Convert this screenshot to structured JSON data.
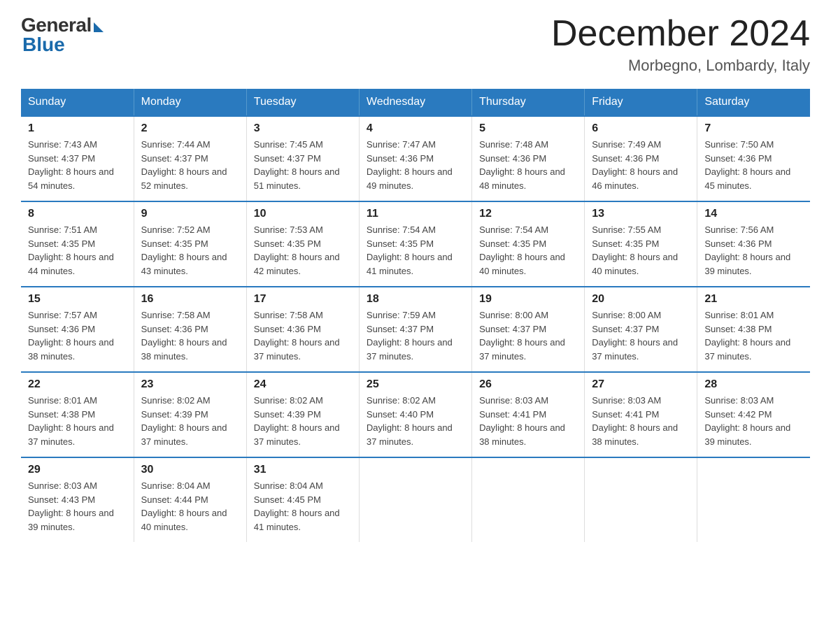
{
  "logo": {
    "general": "General",
    "blue": "Blue"
  },
  "header": {
    "month": "December 2024",
    "location": "Morbegno, Lombardy, Italy"
  },
  "days_of_week": [
    "Sunday",
    "Monday",
    "Tuesday",
    "Wednesday",
    "Thursday",
    "Friday",
    "Saturday"
  ],
  "weeks": [
    [
      {
        "day": "1",
        "sunrise": "7:43 AM",
        "sunset": "4:37 PM",
        "daylight": "8 hours and 54 minutes."
      },
      {
        "day": "2",
        "sunrise": "7:44 AM",
        "sunset": "4:37 PM",
        "daylight": "8 hours and 52 minutes."
      },
      {
        "day": "3",
        "sunrise": "7:45 AM",
        "sunset": "4:37 PM",
        "daylight": "8 hours and 51 minutes."
      },
      {
        "day": "4",
        "sunrise": "7:47 AM",
        "sunset": "4:36 PM",
        "daylight": "8 hours and 49 minutes."
      },
      {
        "day": "5",
        "sunrise": "7:48 AM",
        "sunset": "4:36 PM",
        "daylight": "8 hours and 48 minutes."
      },
      {
        "day": "6",
        "sunrise": "7:49 AM",
        "sunset": "4:36 PM",
        "daylight": "8 hours and 46 minutes."
      },
      {
        "day": "7",
        "sunrise": "7:50 AM",
        "sunset": "4:36 PM",
        "daylight": "8 hours and 45 minutes."
      }
    ],
    [
      {
        "day": "8",
        "sunrise": "7:51 AM",
        "sunset": "4:35 PM",
        "daylight": "8 hours and 44 minutes."
      },
      {
        "day": "9",
        "sunrise": "7:52 AM",
        "sunset": "4:35 PM",
        "daylight": "8 hours and 43 minutes."
      },
      {
        "day": "10",
        "sunrise": "7:53 AM",
        "sunset": "4:35 PM",
        "daylight": "8 hours and 42 minutes."
      },
      {
        "day": "11",
        "sunrise": "7:54 AM",
        "sunset": "4:35 PM",
        "daylight": "8 hours and 41 minutes."
      },
      {
        "day": "12",
        "sunrise": "7:54 AM",
        "sunset": "4:35 PM",
        "daylight": "8 hours and 40 minutes."
      },
      {
        "day": "13",
        "sunrise": "7:55 AM",
        "sunset": "4:35 PM",
        "daylight": "8 hours and 40 minutes."
      },
      {
        "day": "14",
        "sunrise": "7:56 AM",
        "sunset": "4:36 PM",
        "daylight": "8 hours and 39 minutes."
      }
    ],
    [
      {
        "day": "15",
        "sunrise": "7:57 AM",
        "sunset": "4:36 PM",
        "daylight": "8 hours and 38 minutes."
      },
      {
        "day": "16",
        "sunrise": "7:58 AM",
        "sunset": "4:36 PM",
        "daylight": "8 hours and 38 minutes."
      },
      {
        "day": "17",
        "sunrise": "7:58 AM",
        "sunset": "4:36 PM",
        "daylight": "8 hours and 37 minutes."
      },
      {
        "day": "18",
        "sunrise": "7:59 AM",
        "sunset": "4:37 PM",
        "daylight": "8 hours and 37 minutes."
      },
      {
        "day": "19",
        "sunrise": "8:00 AM",
        "sunset": "4:37 PM",
        "daylight": "8 hours and 37 minutes."
      },
      {
        "day": "20",
        "sunrise": "8:00 AM",
        "sunset": "4:37 PM",
        "daylight": "8 hours and 37 minutes."
      },
      {
        "day": "21",
        "sunrise": "8:01 AM",
        "sunset": "4:38 PM",
        "daylight": "8 hours and 37 minutes."
      }
    ],
    [
      {
        "day": "22",
        "sunrise": "8:01 AM",
        "sunset": "4:38 PM",
        "daylight": "8 hours and 37 minutes."
      },
      {
        "day": "23",
        "sunrise": "8:02 AM",
        "sunset": "4:39 PM",
        "daylight": "8 hours and 37 minutes."
      },
      {
        "day": "24",
        "sunrise": "8:02 AM",
        "sunset": "4:39 PM",
        "daylight": "8 hours and 37 minutes."
      },
      {
        "day": "25",
        "sunrise": "8:02 AM",
        "sunset": "4:40 PM",
        "daylight": "8 hours and 37 minutes."
      },
      {
        "day": "26",
        "sunrise": "8:03 AM",
        "sunset": "4:41 PM",
        "daylight": "8 hours and 38 minutes."
      },
      {
        "day": "27",
        "sunrise": "8:03 AM",
        "sunset": "4:41 PM",
        "daylight": "8 hours and 38 minutes."
      },
      {
        "day": "28",
        "sunrise": "8:03 AM",
        "sunset": "4:42 PM",
        "daylight": "8 hours and 39 minutes."
      }
    ],
    [
      {
        "day": "29",
        "sunrise": "8:03 AM",
        "sunset": "4:43 PM",
        "daylight": "8 hours and 39 minutes."
      },
      {
        "day": "30",
        "sunrise": "8:04 AM",
        "sunset": "4:44 PM",
        "daylight": "8 hours and 40 minutes."
      },
      {
        "day": "31",
        "sunrise": "8:04 AM",
        "sunset": "4:45 PM",
        "daylight": "8 hours and 41 minutes."
      },
      null,
      null,
      null,
      null
    ]
  ],
  "labels": {
    "sunrise": "Sunrise:",
    "sunset": "Sunset:",
    "daylight": "Daylight:"
  }
}
